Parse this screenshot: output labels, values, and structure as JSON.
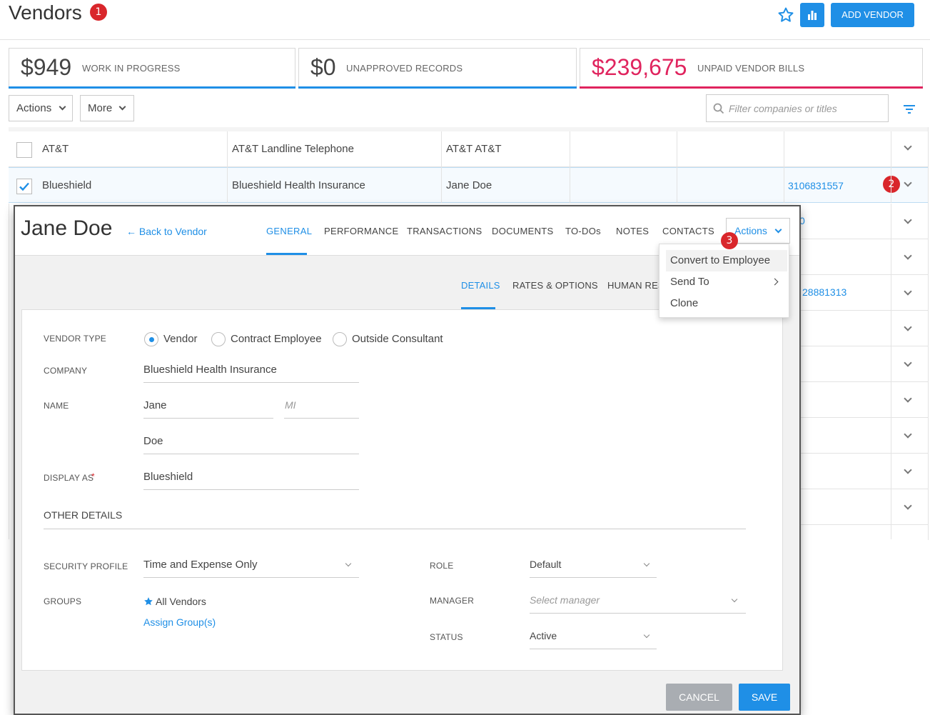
{
  "header": {
    "title": "Vendors",
    "badge_1": "1",
    "add_vendor_label": "ADD VENDOR",
    "star_icon": "star-icon",
    "chart_icon": "bar-chart-icon"
  },
  "summary": [
    {
      "amount": "$949",
      "label": "WORK IN PROGRESS",
      "color": "#1f8fe6"
    },
    {
      "amount": "$0",
      "label": "UNAPPROVED RECORDS",
      "color": "#1f8fe6"
    },
    {
      "amount": "$239,675",
      "label": "UNPAID VENDOR BILLS",
      "color": "#e0245e"
    }
  ],
  "toolbar": {
    "actions_label": "Actions",
    "more_label": "More",
    "filter_placeholder": "Filter companies or titles"
  },
  "table": {
    "rows": [
      {
        "name": "AT&T",
        "company": "AT&T Landline Telephone",
        "contact": "AT&T AT&T",
        "phone": "",
        "checked": false
      },
      {
        "name": "Blueshield",
        "company": "Blueshield Health Insurance",
        "contact": "Jane Doe",
        "phone": "3106831557",
        "checked": true
      }
    ],
    "partial_values": {
      "row3_suffix": "0",
      "row5_phone_suffix": "28881313"
    },
    "badge_2": "2"
  },
  "modal": {
    "name": "Jane Doe",
    "back_label": "← Back to Vendor",
    "tabs": [
      "GENERAL",
      "PERFORMANCE",
      "TRANSACTIONS",
      "DOCUMENTS",
      "TO-DOs",
      "NOTES",
      "CONTACTS"
    ],
    "actions_label": "Actions",
    "badge_3": "3",
    "sub_tabs": [
      "DETAILS",
      "RATES & OPTIONS",
      "HUMAN RES"
    ],
    "form": {
      "vendor_type_label": "VENDOR TYPE",
      "vendor_type_options": [
        "Vendor",
        "Contract Employee",
        "Outside Consultant"
      ],
      "vendor_type_selected": "Vendor",
      "company_label": "COMPANY",
      "company_value": "Blueshield Health Insurance",
      "name_label": "NAME",
      "first_name": "Jane",
      "mi_placeholder": "MI",
      "last_name": "Doe",
      "display_as_label": "DISPLAY AS",
      "required_mark": "*",
      "display_as_value": "Blueshield",
      "other_details_heading": "OTHER DETAILS",
      "security_profile_label": "SECURITY PROFILE",
      "security_profile_value": "Time and Expense Only",
      "groups_label": "GROUPS",
      "group_value": "All Vendors",
      "assign_groups_link": "Assign Group(s)",
      "role_label": "ROLE",
      "role_value": "Default",
      "manager_label": "MANAGER",
      "manager_placeholder": "Select manager",
      "status_label": "STATUS",
      "status_value": "Active"
    },
    "cancel_label": "CANCEL",
    "save_label": "SAVE"
  },
  "actions_menu": {
    "items": [
      "Convert to Employee",
      "Send To",
      "Clone"
    ],
    "highlighted": "Convert to Employee"
  }
}
